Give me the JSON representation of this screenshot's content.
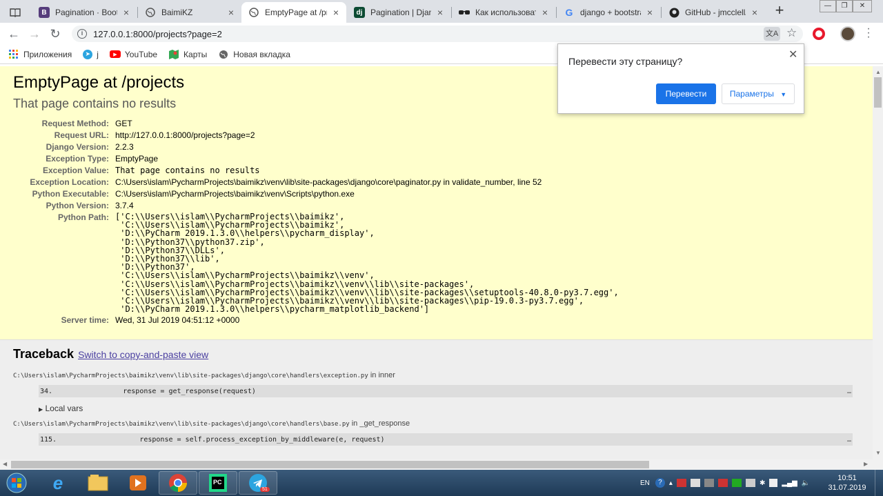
{
  "browser": {
    "tabs": [
      {
        "icon": "book-icon",
        "title": ""
      },
      {
        "icon": "bootstrap-icon",
        "title": "Pagination · Bootst"
      },
      {
        "icon": "globe-icon",
        "title": "BaimiKZ"
      },
      {
        "icon": "globe-icon",
        "title": "EmptyPage at /prc",
        "active": true
      },
      {
        "icon": "django-icon",
        "title": "Pagination | Djang"
      },
      {
        "icon": "sunglasses-icon",
        "title": "Как использоват"
      },
      {
        "icon": "google-icon",
        "title": "django + bootstra"
      },
      {
        "icon": "github-icon",
        "title": "GitHub - jmcclell/c"
      }
    ],
    "url": "127.0.0.1:8000/projects?page=2",
    "bookmarks": [
      {
        "icon": "apps-grid-icon",
        "label": "Приложения"
      },
      {
        "icon": "telegram-icon",
        "label": "j"
      },
      {
        "icon": "youtube-icon",
        "label": "YouTube"
      },
      {
        "icon": "maps-icon",
        "label": "Карты"
      },
      {
        "icon": "globe-icon",
        "label": "Новая вкладка"
      }
    ]
  },
  "translate_popup": {
    "title": "Перевести эту страницу?",
    "translate_button": "Перевести",
    "options_button": "Параметры"
  },
  "summary": {
    "title": "EmptyPage at /projects",
    "subtitle": "That page contains no results",
    "rows": [
      {
        "label": "Request Method:",
        "value": "GET"
      },
      {
        "label": "Request URL:",
        "value": "http://127.0.0.1:8000/projects?page=2"
      },
      {
        "label": "Django Version:",
        "value": "2.2.3"
      },
      {
        "label": "Exception Type:",
        "value": "EmptyPage"
      },
      {
        "label": "Exception Value:",
        "value": "That page contains no results"
      },
      {
        "label": "Exception Location:",
        "value": "C:\\Users\\islam\\PycharmProjects\\baimikz\\venv\\lib\\site-packages\\django\\core\\paginator.py in validate_number, line 52"
      },
      {
        "label": "Python Executable:",
        "value": "C:\\Users\\islam\\PycharmProjects\\baimikz\\venv\\Scripts\\python.exe"
      },
      {
        "label": "Python Version:",
        "value": "3.7.4"
      },
      {
        "label": "Python Path:",
        "value": "['C:\\\\Users\\\\islam\\\\PycharmProjects\\\\baimikz',\n 'C:\\\\Users\\\\islam\\\\PycharmProjects\\\\baimikz',\n 'D:\\\\PyCharm 2019.1.3.0\\\\helpers\\\\pycharm_display',\n 'D:\\\\Python37\\\\python37.zip',\n 'D:\\\\Python37\\\\DLLs',\n 'D:\\\\Python37\\\\lib',\n 'D:\\\\Python37',\n 'C:\\\\Users\\\\islam\\\\PycharmProjects\\\\baimikz\\\\venv',\n 'C:\\\\Users\\\\islam\\\\PycharmProjects\\\\baimikz\\\\venv\\\\lib\\\\site-packages',\n 'C:\\\\Users\\\\islam\\\\PycharmProjects\\\\baimikz\\\\venv\\\\lib\\\\site-packages\\\\setuptools-40.8.0-py3.7.egg',\n 'C:\\\\Users\\\\islam\\\\PycharmProjects\\\\baimikz\\\\venv\\\\lib\\\\site-packages\\\\pip-19.0.3-py3.7.egg',\n 'D:\\\\PyCharm 2019.1.3.0\\\\helpers\\\\pycharm_matplotlib_backend']"
      },
      {
        "label": "Server time:",
        "value": "Wed, 31 Jul 2019 04:51:12 +0000"
      }
    ]
  },
  "traceback": {
    "title": "Traceback",
    "switch_link": "Switch to copy-and-paste view",
    "frames": [
      {
        "path": "C:\\Users\\islam\\PycharmProjects\\baimikz\\venv\\lib\\site-packages\\django\\core\\handlers\\exception.py",
        "in": "in",
        "func": "inner",
        "line_no": "34.",
        "code": "            response = get_response(request)",
        "dots": "…",
        "local_vars": "Local vars"
      },
      {
        "path": "C:\\Users\\islam\\PycharmProjects\\baimikz\\venv\\lib\\site-packages\\django\\core\\handlers\\base.py",
        "in": "in",
        "func": "_get_response",
        "line_no": "115.",
        "code": "                response = self.process_exception_by_middleware(e, request)",
        "dots": "…"
      }
    ]
  },
  "taskbar": {
    "apps": [
      "windows-start-icon",
      "ie-icon",
      "explorer-icon",
      "media-player-icon",
      "chrome-icon",
      "pycharm-icon",
      "telegram-icon"
    ],
    "telegram_badge": "51",
    "lang": "EN",
    "time": "10:51",
    "date": "31.07.2019"
  },
  "colors": {
    "summary_bg": "#ffffcc",
    "traceback_bg": "#eeeeee",
    "link": "#4a3fa0",
    "translate_btn": "#1a73e8"
  }
}
